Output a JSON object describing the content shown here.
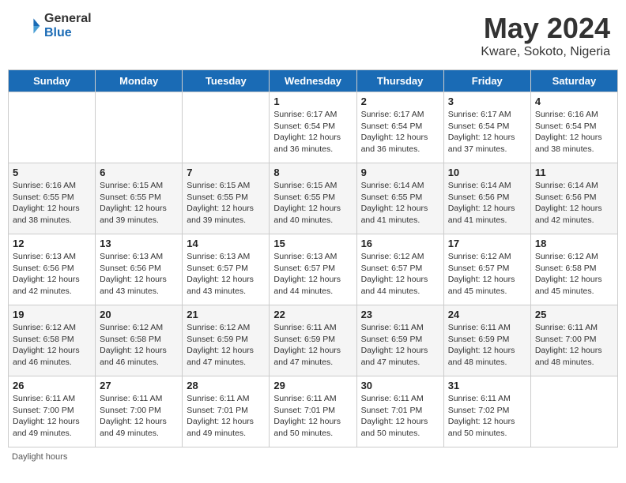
{
  "header": {
    "logo_general": "General",
    "logo_blue": "Blue",
    "month_title": "May 2024",
    "location": "Kware, Sokoto, Nigeria"
  },
  "days_of_week": [
    "Sunday",
    "Monday",
    "Tuesday",
    "Wednesday",
    "Thursday",
    "Friday",
    "Saturday"
  ],
  "footer": {
    "daylight_label": "Daylight hours"
  },
  "weeks": [
    [
      {
        "day": "",
        "info": ""
      },
      {
        "day": "",
        "info": ""
      },
      {
        "day": "",
        "info": ""
      },
      {
        "day": "1",
        "info": "Sunrise: 6:17 AM\nSunset: 6:54 PM\nDaylight: 12 hours\nand 36 minutes."
      },
      {
        "day": "2",
        "info": "Sunrise: 6:17 AM\nSunset: 6:54 PM\nDaylight: 12 hours\nand 36 minutes."
      },
      {
        "day": "3",
        "info": "Sunrise: 6:17 AM\nSunset: 6:54 PM\nDaylight: 12 hours\nand 37 minutes."
      },
      {
        "day": "4",
        "info": "Sunrise: 6:16 AM\nSunset: 6:54 PM\nDaylight: 12 hours\nand 38 minutes."
      }
    ],
    [
      {
        "day": "5",
        "info": "Sunrise: 6:16 AM\nSunset: 6:55 PM\nDaylight: 12 hours\nand 38 minutes."
      },
      {
        "day": "6",
        "info": "Sunrise: 6:15 AM\nSunset: 6:55 PM\nDaylight: 12 hours\nand 39 minutes."
      },
      {
        "day": "7",
        "info": "Sunrise: 6:15 AM\nSunset: 6:55 PM\nDaylight: 12 hours\nand 39 minutes."
      },
      {
        "day": "8",
        "info": "Sunrise: 6:15 AM\nSunset: 6:55 PM\nDaylight: 12 hours\nand 40 minutes."
      },
      {
        "day": "9",
        "info": "Sunrise: 6:14 AM\nSunset: 6:55 PM\nDaylight: 12 hours\nand 41 minutes."
      },
      {
        "day": "10",
        "info": "Sunrise: 6:14 AM\nSunset: 6:56 PM\nDaylight: 12 hours\nand 41 minutes."
      },
      {
        "day": "11",
        "info": "Sunrise: 6:14 AM\nSunset: 6:56 PM\nDaylight: 12 hours\nand 42 minutes."
      }
    ],
    [
      {
        "day": "12",
        "info": "Sunrise: 6:13 AM\nSunset: 6:56 PM\nDaylight: 12 hours\nand 42 minutes."
      },
      {
        "day": "13",
        "info": "Sunrise: 6:13 AM\nSunset: 6:56 PM\nDaylight: 12 hours\nand 43 minutes."
      },
      {
        "day": "14",
        "info": "Sunrise: 6:13 AM\nSunset: 6:57 PM\nDaylight: 12 hours\nand 43 minutes."
      },
      {
        "day": "15",
        "info": "Sunrise: 6:13 AM\nSunset: 6:57 PM\nDaylight: 12 hours\nand 44 minutes."
      },
      {
        "day": "16",
        "info": "Sunrise: 6:12 AM\nSunset: 6:57 PM\nDaylight: 12 hours\nand 44 minutes."
      },
      {
        "day": "17",
        "info": "Sunrise: 6:12 AM\nSunset: 6:57 PM\nDaylight: 12 hours\nand 45 minutes."
      },
      {
        "day": "18",
        "info": "Sunrise: 6:12 AM\nSunset: 6:58 PM\nDaylight: 12 hours\nand 45 minutes."
      }
    ],
    [
      {
        "day": "19",
        "info": "Sunrise: 6:12 AM\nSunset: 6:58 PM\nDaylight: 12 hours\nand 46 minutes."
      },
      {
        "day": "20",
        "info": "Sunrise: 6:12 AM\nSunset: 6:58 PM\nDaylight: 12 hours\nand 46 minutes."
      },
      {
        "day": "21",
        "info": "Sunrise: 6:12 AM\nSunset: 6:59 PM\nDaylight: 12 hours\nand 47 minutes."
      },
      {
        "day": "22",
        "info": "Sunrise: 6:11 AM\nSunset: 6:59 PM\nDaylight: 12 hours\nand 47 minutes."
      },
      {
        "day": "23",
        "info": "Sunrise: 6:11 AM\nSunset: 6:59 PM\nDaylight: 12 hours\nand 47 minutes."
      },
      {
        "day": "24",
        "info": "Sunrise: 6:11 AM\nSunset: 6:59 PM\nDaylight: 12 hours\nand 48 minutes."
      },
      {
        "day": "25",
        "info": "Sunrise: 6:11 AM\nSunset: 7:00 PM\nDaylight: 12 hours\nand 48 minutes."
      }
    ],
    [
      {
        "day": "26",
        "info": "Sunrise: 6:11 AM\nSunset: 7:00 PM\nDaylight: 12 hours\nand 49 minutes."
      },
      {
        "day": "27",
        "info": "Sunrise: 6:11 AM\nSunset: 7:00 PM\nDaylight: 12 hours\nand 49 minutes."
      },
      {
        "day": "28",
        "info": "Sunrise: 6:11 AM\nSunset: 7:01 PM\nDaylight: 12 hours\nand 49 minutes."
      },
      {
        "day": "29",
        "info": "Sunrise: 6:11 AM\nSunset: 7:01 PM\nDaylight: 12 hours\nand 50 minutes."
      },
      {
        "day": "30",
        "info": "Sunrise: 6:11 AM\nSunset: 7:01 PM\nDaylight: 12 hours\nand 50 minutes."
      },
      {
        "day": "31",
        "info": "Sunrise: 6:11 AM\nSunset: 7:02 PM\nDaylight: 12 hours\nand 50 minutes."
      },
      {
        "day": "",
        "info": ""
      }
    ]
  ]
}
